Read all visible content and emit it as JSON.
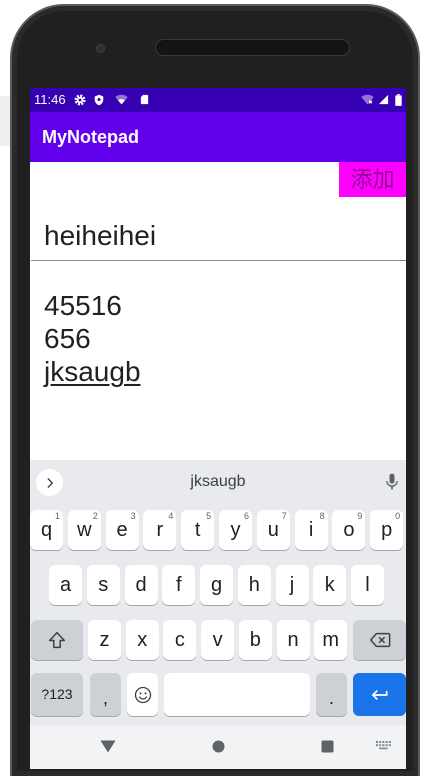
{
  "colors": {
    "status_bar": "#3700B3",
    "app_bar": "#6200EE",
    "add_button_bg": "#FF00FF",
    "add_button_text": "#8B0A8B",
    "keyboard_bg": "#E8EAED",
    "key_bg": "#FFFFFF",
    "function_key_bg": "#CDD0D5",
    "enter_key_bg": "#1A73E8",
    "nav_bar_bg": "#F1F3F4"
  },
  "status_bar": {
    "time": "11:46",
    "left_icons": [
      "gear-icon",
      "shield-icon",
      "wifi-question-icon",
      "sd-card-icon"
    ],
    "right_icons": [
      "wifi-off-icon",
      "cell-signal-icon",
      "battery-icon"
    ]
  },
  "app_bar": {
    "title": "MyNotepad"
  },
  "add_button": {
    "label": "添加"
  },
  "title_input": {
    "value": "heiheihei"
  },
  "content_input": {
    "lines": [
      "45516",
      "656"
    ],
    "composing_word": "jksaugb"
  },
  "keyboard": {
    "suggestion": "jksaugb",
    "rows": [
      [
        {
          "label": "q",
          "hint": "1"
        },
        {
          "label": "w",
          "hint": "2"
        },
        {
          "label": "e",
          "hint": "3"
        },
        {
          "label": "r",
          "hint": "4"
        },
        {
          "label": "t",
          "hint": "5"
        },
        {
          "label": "y",
          "hint": "6"
        },
        {
          "label": "u",
          "hint": "7"
        },
        {
          "label": "i",
          "hint": "8"
        },
        {
          "label": "o",
          "hint": "9"
        },
        {
          "label": "p",
          "hint": "0"
        }
      ],
      [
        {
          "label": "a"
        },
        {
          "label": "s"
        },
        {
          "label": "d"
        },
        {
          "label": "f"
        },
        {
          "label": "g"
        },
        {
          "label": "h"
        },
        {
          "label": "j"
        },
        {
          "label": "k"
        },
        {
          "label": "l"
        }
      ],
      [
        {
          "label": "z"
        },
        {
          "label": "x"
        },
        {
          "label": "c"
        },
        {
          "label": "v"
        },
        {
          "label": "b"
        },
        {
          "label": "n"
        },
        {
          "label": "m"
        }
      ]
    ],
    "symbols_key": "?123",
    "comma_key": ",",
    "period_key": ".",
    "icons": {
      "toolbar": "chevron-right-icon",
      "voice": "mic-icon",
      "shift": "shift-icon",
      "backspace": "backspace-icon",
      "emoji": "emoji-icon",
      "enter": "enter-icon"
    }
  },
  "nav_bar": {
    "icons": [
      "back-icon",
      "home-icon",
      "recents-icon",
      "keyboard-switch-icon"
    ]
  }
}
